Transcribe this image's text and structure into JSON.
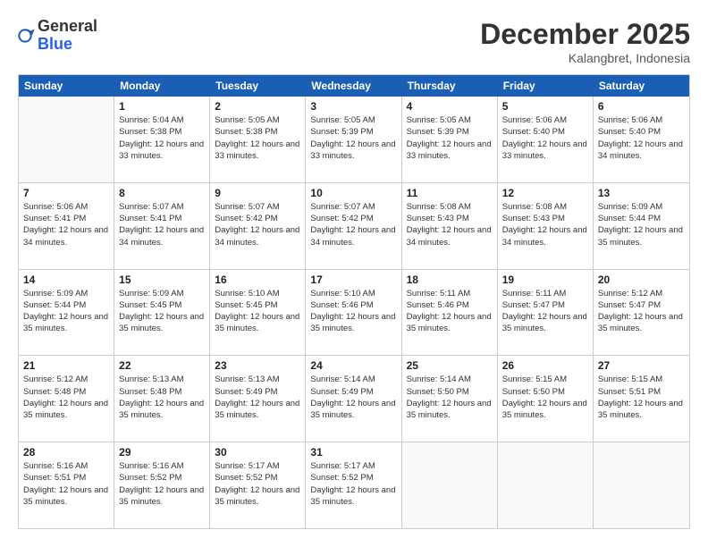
{
  "logo": {
    "general": "General",
    "blue": "Blue"
  },
  "header": {
    "month": "December 2025",
    "location": "Kalangbret, Indonesia"
  },
  "weekdays": [
    "Sunday",
    "Monday",
    "Tuesday",
    "Wednesday",
    "Thursday",
    "Friday",
    "Saturday"
  ],
  "rows": [
    [
      {
        "day": "",
        "empty": true
      },
      {
        "day": "1",
        "rise": "Sunrise: 5:04 AM",
        "set": "Sunset: 5:38 PM",
        "daylight": "Daylight: 12 hours and 33 minutes."
      },
      {
        "day": "2",
        "rise": "Sunrise: 5:05 AM",
        "set": "Sunset: 5:38 PM",
        "daylight": "Daylight: 12 hours and 33 minutes."
      },
      {
        "day": "3",
        "rise": "Sunrise: 5:05 AM",
        "set": "Sunset: 5:39 PM",
        "daylight": "Daylight: 12 hours and 33 minutes."
      },
      {
        "day": "4",
        "rise": "Sunrise: 5:05 AM",
        "set": "Sunset: 5:39 PM",
        "daylight": "Daylight: 12 hours and 33 minutes."
      },
      {
        "day": "5",
        "rise": "Sunrise: 5:06 AM",
        "set": "Sunset: 5:40 PM",
        "daylight": "Daylight: 12 hours and 33 minutes."
      },
      {
        "day": "6",
        "rise": "Sunrise: 5:06 AM",
        "set": "Sunset: 5:40 PM",
        "daylight": "Daylight: 12 hours and 34 minutes."
      }
    ],
    [
      {
        "day": "7",
        "rise": "Sunrise: 5:06 AM",
        "set": "Sunset: 5:41 PM",
        "daylight": "Daylight: 12 hours and 34 minutes."
      },
      {
        "day": "8",
        "rise": "Sunrise: 5:07 AM",
        "set": "Sunset: 5:41 PM",
        "daylight": "Daylight: 12 hours and 34 minutes."
      },
      {
        "day": "9",
        "rise": "Sunrise: 5:07 AM",
        "set": "Sunset: 5:42 PM",
        "daylight": "Daylight: 12 hours and 34 minutes."
      },
      {
        "day": "10",
        "rise": "Sunrise: 5:07 AM",
        "set": "Sunset: 5:42 PM",
        "daylight": "Daylight: 12 hours and 34 minutes."
      },
      {
        "day": "11",
        "rise": "Sunrise: 5:08 AM",
        "set": "Sunset: 5:43 PM",
        "daylight": "Daylight: 12 hours and 34 minutes."
      },
      {
        "day": "12",
        "rise": "Sunrise: 5:08 AM",
        "set": "Sunset: 5:43 PM",
        "daylight": "Daylight: 12 hours and 34 minutes."
      },
      {
        "day": "13",
        "rise": "Sunrise: 5:09 AM",
        "set": "Sunset: 5:44 PM",
        "daylight": "Daylight: 12 hours and 35 minutes."
      }
    ],
    [
      {
        "day": "14",
        "rise": "Sunrise: 5:09 AM",
        "set": "Sunset: 5:44 PM",
        "daylight": "Daylight: 12 hours and 35 minutes."
      },
      {
        "day": "15",
        "rise": "Sunrise: 5:09 AM",
        "set": "Sunset: 5:45 PM",
        "daylight": "Daylight: 12 hours and 35 minutes."
      },
      {
        "day": "16",
        "rise": "Sunrise: 5:10 AM",
        "set": "Sunset: 5:45 PM",
        "daylight": "Daylight: 12 hours and 35 minutes."
      },
      {
        "day": "17",
        "rise": "Sunrise: 5:10 AM",
        "set": "Sunset: 5:46 PM",
        "daylight": "Daylight: 12 hours and 35 minutes."
      },
      {
        "day": "18",
        "rise": "Sunrise: 5:11 AM",
        "set": "Sunset: 5:46 PM",
        "daylight": "Daylight: 12 hours and 35 minutes."
      },
      {
        "day": "19",
        "rise": "Sunrise: 5:11 AM",
        "set": "Sunset: 5:47 PM",
        "daylight": "Daylight: 12 hours and 35 minutes."
      },
      {
        "day": "20",
        "rise": "Sunrise: 5:12 AM",
        "set": "Sunset: 5:47 PM",
        "daylight": "Daylight: 12 hours and 35 minutes."
      }
    ],
    [
      {
        "day": "21",
        "rise": "Sunrise: 5:12 AM",
        "set": "Sunset: 5:48 PM",
        "daylight": "Daylight: 12 hours and 35 minutes."
      },
      {
        "day": "22",
        "rise": "Sunrise: 5:13 AM",
        "set": "Sunset: 5:48 PM",
        "daylight": "Daylight: 12 hours and 35 minutes."
      },
      {
        "day": "23",
        "rise": "Sunrise: 5:13 AM",
        "set": "Sunset: 5:49 PM",
        "daylight": "Daylight: 12 hours and 35 minutes."
      },
      {
        "day": "24",
        "rise": "Sunrise: 5:14 AM",
        "set": "Sunset: 5:49 PM",
        "daylight": "Daylight: 12 hours and 35 minutes."
      },
      {
        "day": "25",
        "rise": "Sunrise: 5:14 AM",
        "set": "Sunset: 5:50 PM",
        "daylight": "Daylight: 12 hours and 35 minutes."
      },
      {
        "day": "26",
        "rise": "Sunrise: 5:15 AM",
        "set": "Sunset: 5:50 PM",
        "daylight": "Daylight: 12 hours and 35 minutes."
      },
      {
        "day": "27",
        "rise": "Sunrise: 5:15 AM",
        "set": "Sunset: 5:51 PM",
        "daylight": "Daylight: 12 hours and 35 minutes."
      }
    ],
    [
      {
        "day": "28",
        "rise": "Sunrise: 5:16 AM",
        "set": "Sunset: 5:51 PM",
        "daylight": "Daylight: 12 hours and 35 minutes."
      },
      {
        "day": "29",
        "rise": "Sunrise: 5:16 AM",
        "set": "Sunset: 5:52 PM",
        "daylight": "Daylight: 12 hours and 35 minutes."
      },
      {
        "day": "30",
        "rise": "Sunrise: 5:17 AM",
        "set": "Sunset: 5:52 PM",
        "daylight": "Daylight: 12 hours and 35 minutes."
      },
      {
        "day": "31",
        "rise": "Sunrise: 5:17 AM",
        "set": "Sunset: 5:52 PM",
        "daylight": "Daylight: 12 hours and 35 minutes."
      },
      {
        "day": "",
        "empty": true
      },
      {
        "day": "",
        "empty": true
      },
      {
        "day": "",
        "empty": true
      }
    ]
  ]
}
